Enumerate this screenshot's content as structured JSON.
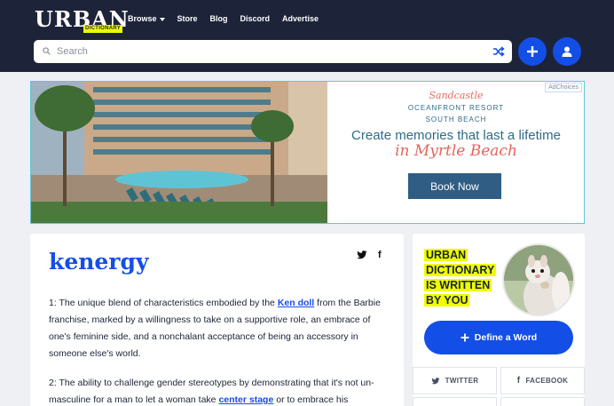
{
  "header": {
    "logo_text": "URBAN",
    "logo_sub": "DICTIONARY",
    "nav": [
      "Browse",
      "Store",
      "Blog",
      "Discord",
      "Advertise"
    ]
  },
  "search": {
    "placeholder": "Search"
  },
  "ad": {
    "choices": "AdChoices",
    "brand_script": "Sandcastle",
    "resort": "OCEANFRONT RESORT",
    "beach": "SOUTH BEACH",
    "headline": "Create memories that last a lifetime",
    "location": "in Myrtle Beach",
    "cta": "Book Now"
  },
  "definition": {
    "word": "kenergy",
    "meaning1_a": "1: The unique blend of characteristics embodied by the ",
    "meaning1_link": "Ken doll",
    "meaning1_b": " from the Barbie franchise, marked by a willingness to take on a supportive role, an embrace of one's feminine side, and a nonchalant acceptance of being an accessory in someone else's world.",
    "meaning2_a": "2: The ability to challenge gender stereotypes by demonstrating that it's not un-masculine for a man to let a woman take ",
    "meaning2_link": "center stage",
    "meaning2_b": " or to embrace his"
  },
  "sidebar": {
    "tagline": [
      "URBAN",
      "DICTIONARY",
      "IS WRITTEN",
      "BY YOU"
    ],
    "define_button": "Define a Word",
    "twitter": "TWITTER",
    "facebook": "FACEBOOK"
  },
  "colors": {
    "header_bg": "#1d2439",
    "accent_blue": "#134fe6",
    "highlight_yellow": "#efff00"
  }
}
